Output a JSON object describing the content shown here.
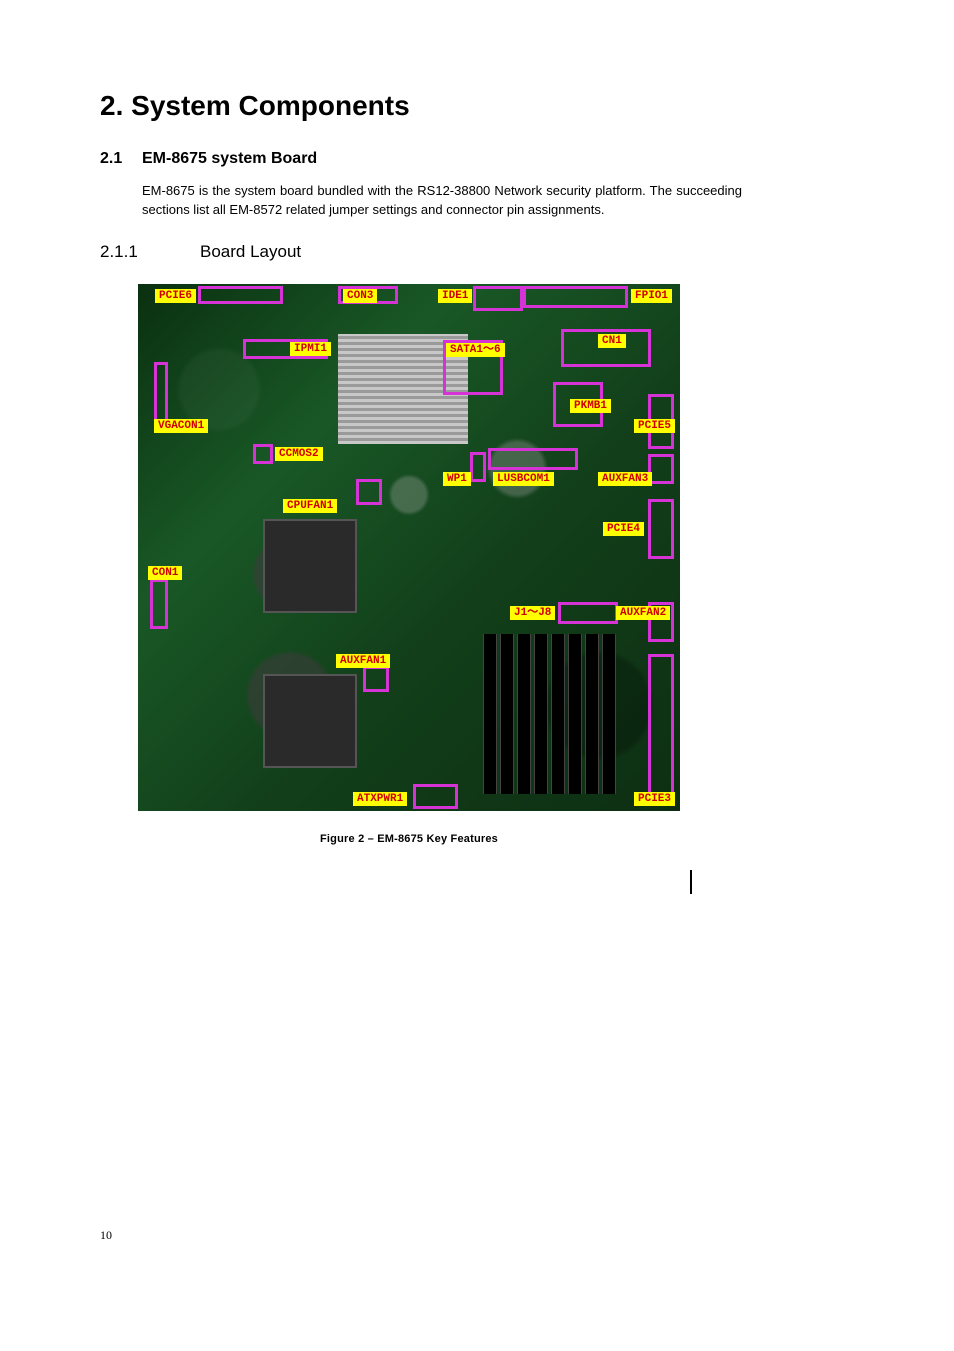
{
  "heading": {
    "number": "2.",
    "title": "System Components"
  },
  "section": {
    "number": "2.1",
    "title": "EM-8675 system Board",
    "paragraph": "EM-8675 is the system board bundled with the RS12-38800 Network security platform. The succeeding sections list all EM-8572 related jumper settings and connector pin assignments."
  },
  "subsection": {
    "number": "2.1.1",
    "title": "Board Layout"
  },
  "figure": {
    "caption": "Figure 2 – EM-8675 Key Features",
    "labels": {
      "pcie6": "PCIE6",
      "con3": "CON3",
      "ide1": "IDE1",
      "fpio1": "FPIO1",
      "ipmi1": "IPMI1",
      "sata": "SATA1～6",
      "cn1": "CN1",
      "pkmb1": "PKMB1",
      "vgacon1": "VGACON1",
      "pcie5": "PCIE5",
      "ccmos2": "CCMOS2",
      "wp1": "WP1",
      "lusbcom1": "LUSBCOM1",
      "auxfan3": "AUXFAN3",
      "cpufan1": "CPUFAN1",
      "pcie4": "PCIE4",
      "con1": "CON1",
      "j1j8": "J1～J8",
      "auxfan2": "AUXFAN2",
      "auxfan1": "AUXFAN1",
      "atxpwr1": "ATXPWR1",
      "pcie3": "PCIE3"
    }
  },
  "pageNumber": "10"
}
